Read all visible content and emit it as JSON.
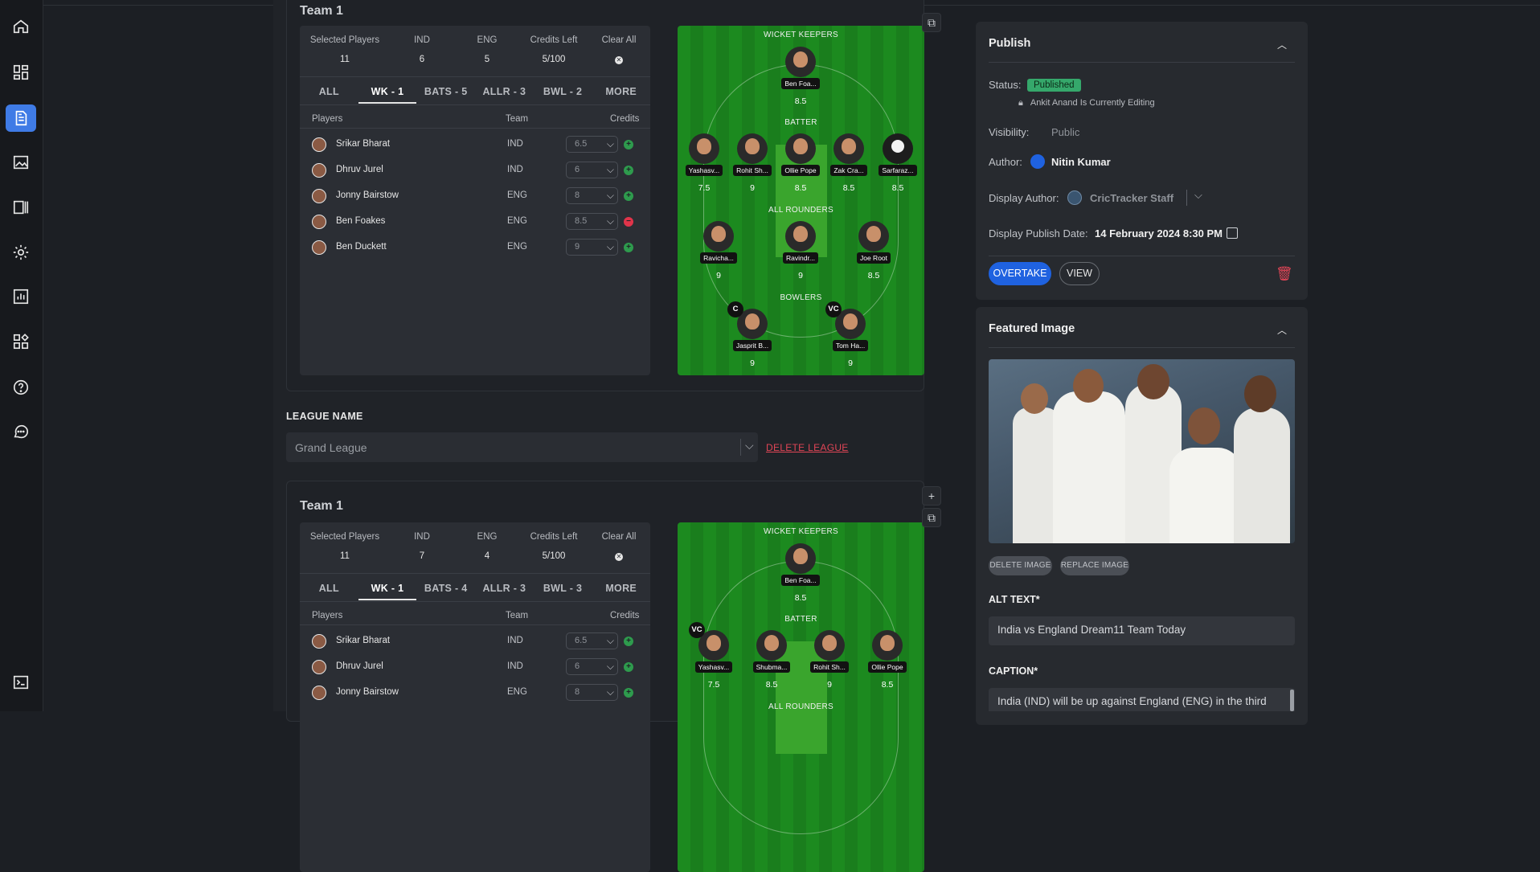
{
  "rail": {
    "items": [
      {
        "name": "home-icon"
      },
      {
        "name": "dashboard-icon"
      },
      {
        "name": "document-icon"
      },
      {
        "name": "image-icon"
      },
      {
        "name": "columns-icon"
      },
      {
        "name": "gear-icon"
      },
      {
        "name": "analytics-icon"
      },
      {
        "name": "widgets-icon"
      },
      {
        "name": "help-icon"
      },
      {
        "name": "chat-icon"
      }
    ],
    "bottom": {
      "name": "collapse-icon"
    },
    "active_index": 2
  },
  "team_cards": [
    {
      "title": "Team 1",
      "stats": {
        "labels": [
          "Selected Players",
          "IND",
          "ENG",
          "Credits Left",
          "Clear All"
        ],
        "values": [
          "11",
          "6",
          "5",
          "5/100"
        ]
      },
      "tabs": [
        "ALL",
        "WK - 1",
        "BATS - 5",
        "ALLR - 3",
        "BWL - 2",
        "MORE"
      ],
      "active_tab": 1,
      "columns": [
        "Players",
        "Team",
        "Credits"
      ],
      "players": [
        {
          "name": "Srikar Bharat",
          "team": "IND",
          "credits": "6.5",
          "action": "add"
        },
        {
          "name": "Dhruv Jurel",
          "team": "IND",
          "credits": "6",
          "action": "add"
        },
        {
          "name": "Jonny Bairstow",
          "team": "ENG",
          "credits": "8",
          "action": "add"
        },
        {
          "name": "Ben Foakes",
          "team": "ENG",
          "credits": "8.5",
          "action": "remove"
        },
        {
          "name": "Ben Duckett",
          "team": "ENG",
          "credits": "9",
          "action": "add"
        }
      ],
      "pitch": {
        "sections": [
          "WICKET KEEPERS",
          "BATTER",
          "ALL ROUNDERS",
          "BOWLERS"
        ],
        "wk": [
          {
            "name": "Ben Foa...",
            "pts": "8.5"
          }
        ],
        "bat": [
          {
            "name": "Yashasv...",
            "pts": "7.5"
          },
          {
            "name": "Rohit Sh...",
            "pts": "9"
          },
          {
            "name": "Ollie Pope",
            "pts": "8.5"
          },
          {
            "name": "Zak Cra...",
            "pts": "8.5"
          },
          {
            "name": "Sarfaraz...",
            "pts": "8.5"
          }
        ],
        "allr": [
          {
            "name": "Ravicha...",
            "pts": "9"
          },
          {
            "name": "Ravindr...",
            "pts": "9"
          },
          {
            "name": "Joe Root",
            "pts": "8.5"
          }
        ],
        "bowl": [
          {
            "name": "Jasprit B...",
            "pts": "9",
            "badge": "C"
          },
          {
            "name": "Tom Ha...",
            "pts": "9",
            "badge": "VC"
          }
        ]
      }
    },
    {
      "title": "Team 1",
      "stats": {
        "labels": [
          "Selected Players",
          "IND",
          "ENG",
          "Credits Left",
          "Clear All"
        ],
        "values": [
          "11",
          "7",
          "4",
          "5/100"
        ]
      },
      "tabs": [
        "ALL",
        "WK - 1",
        "BATS - 4",
        "ALLR - 3",
        "BWL - 3",
        "MORE"
      ],
      "active_tab": 1,
      "columns": [
        "Players",
        "Team",
        "Credits"
      ],
      "players": [
        {
          "name": "Srikar Bharat",
          "team": "IND",
          "credits": "6.5",
          "action": "add"
        },
        {
          "name": "Dhruv Jurel",
          "team": "IND",
          "credits": "6",
          "action": "add"
        },
        {
          "name": "Jonny Bairstow",
          "team": "ENG",
          "credits": "8",
          "action": "add"
        }
      ],
      "pitch": {
        "sections": [
          "WICKET KEEPERS",
          "BATTER",
          "ALL ROUNDERS"
        ],
        "wk": [
          {
            "name": "Ben Foa...",
            "pts": "8.5"
          }
        ],
        "bat": [
          {
            "name": "Yashasv...",
            "pts": "7.5",
            "badge": "VC"
          },
          {
            "name": "Shubma...",
            "pts": "8.5"
          },
          {
            "name": "Rohit Sh...",
            "pts": "9"
          },
          {
            "name": "Ollie Pope",
            "pts": "8.5"
          }
        ]
      }
    }
  ],
  "league": {
    "label": "LEAGUE NAME",
    "value": "Grand League",
    "delete_label": "DELETE LEAGUE"
  },
  "publish": {
    "title": "Publish",
    "status_label": "Status:",
    "status_value": "Published",
    "editing_note": "Ankit Anand Is Currently Editing",
    "visibility_label": "Visibility:",
    "visibility_value": "Public",
    "author_label": "Author:",
    "author_value": "Nitin Kumar",
    "display_author_label": "Display Author:",
    "display_author_value": "CricTracker Staff",
    "date_label": "Display Publish Date:",
    "date_value": "14 February 2024 8:30 PM",
    "overtake_label": "OVERTAKE",
    "view_label": "VIEW"
  },
  "featured": {
    "title": "Featured Image",
    "delete_label": "DELETE IMAGE",
    "replace_label": "REPLACE IMAGE",
    "alt_label": "ALT TEXT*",
    "alt_value": "India vs England Dream11 Team Today",
    "caption_label": "CAPTION*",
    "caption_value": "India (IND) will be up against England (ENG) in the third"
  },
  "colors": {
    "accent": "#3f7be6",
    "primary_button": "#1f62e0",
    "published_badge": "#35a86b",
    "danger": "#e04556",
    "pitch_green": "#1c8a1f"
  }
}
